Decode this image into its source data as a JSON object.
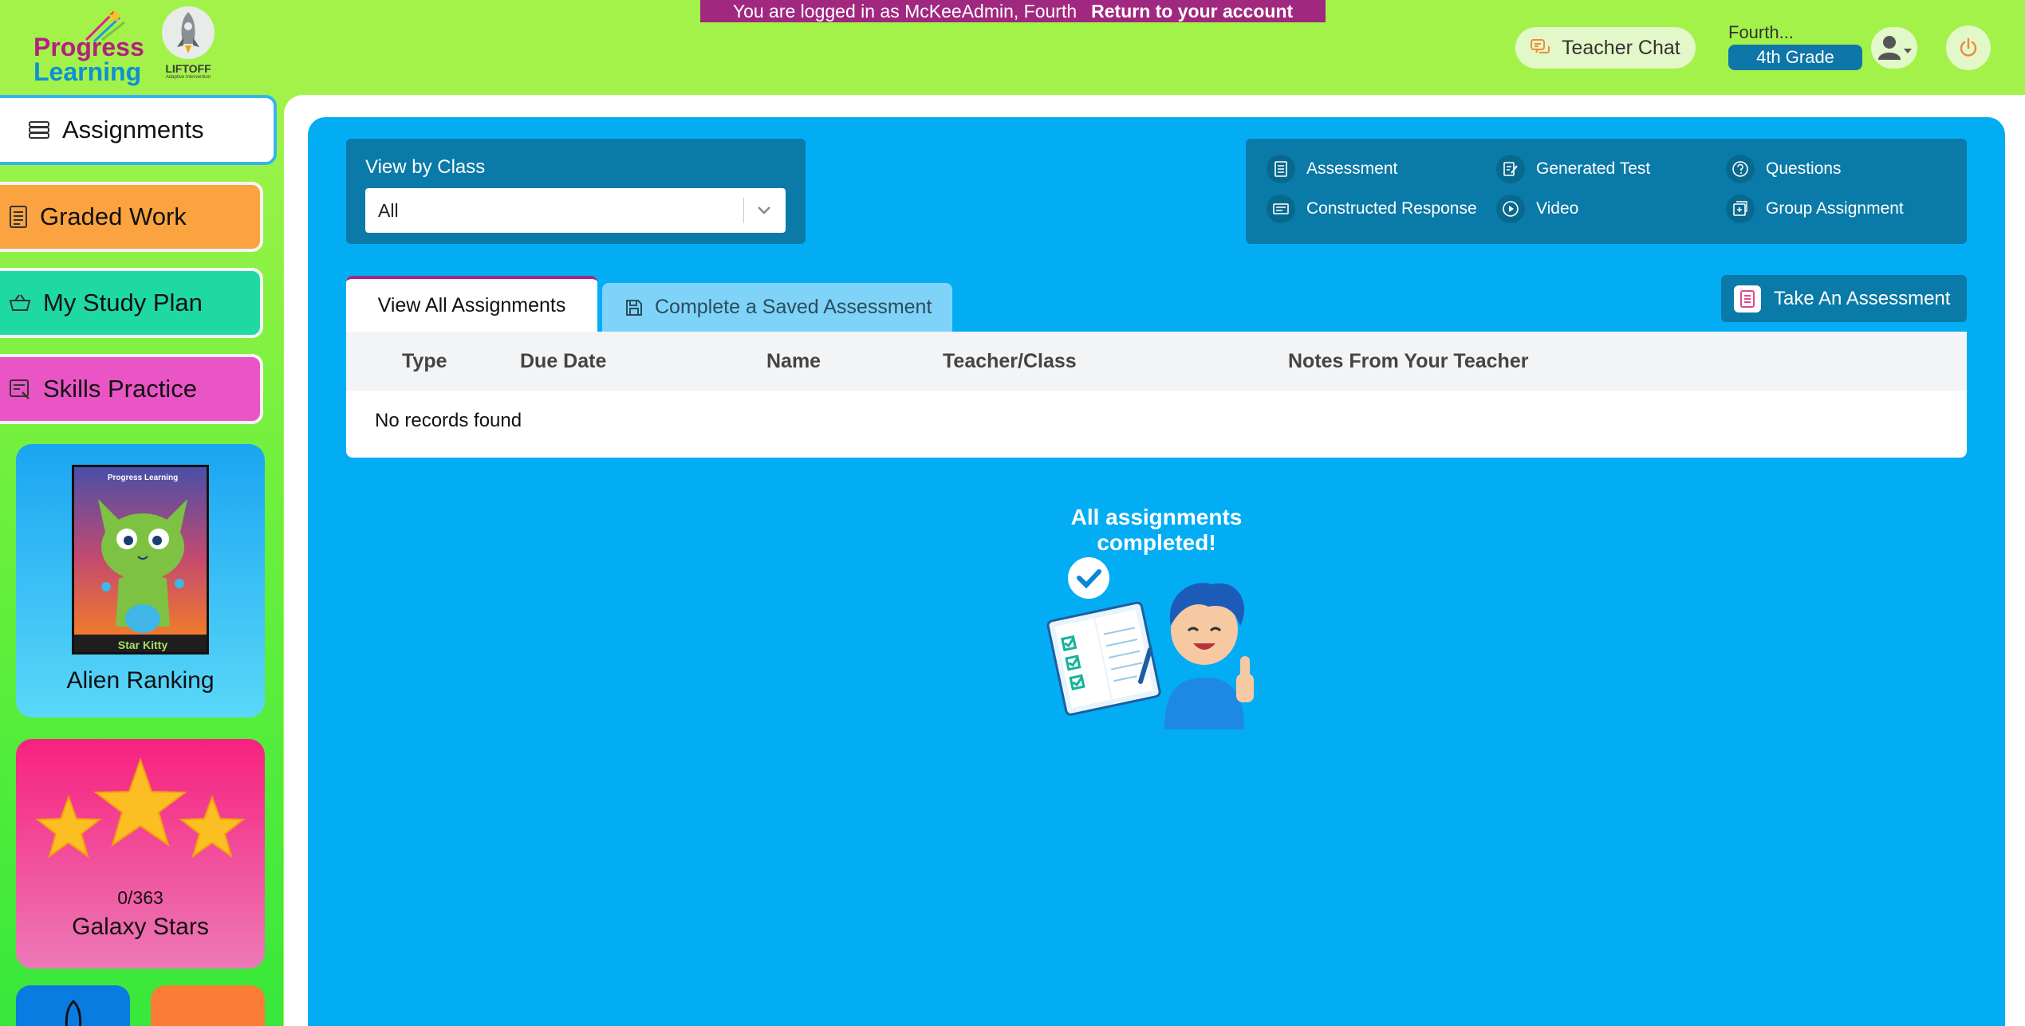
{
  "banner": {
    "logged_in_text": "You are logged in as McKeeAdmin, Fourth",
    "return_link": "Return to your account"
  },
  "brand": {
    "logo_line1": "Progress",
    "logo_line2": "Learning",
    "liftoff_word": "LIFTOFF",
    "liftoff_sub": "Adaptive Intervention"
  },
  "header": {
    "teacher_chat_label": "Teacher Chat",
    "user_name": "Fourth...",
    "grade": "4th Grade"
  },
  "sidebar": {
    "items": [
      {
        "label": "Assignments",
        "icon": "stack-icon"
      },
      {
        "label": "Graded Work",
        "icon": "document-icon"
      },
      {
        "label": "My Study Plan",
        "icon": "basket-icon"
      },
      {
        "label": "Skills Practice",
        "icon": "practice-icon"
      }
    ],
    "alien_card": {
      "title": "Alien Ranking",
      "poster_label": "Star Kitty",
      "poster_brand": "Progress Learning"
    },
    "stars_card": {
      "count": "0/363",
      "title": "Galaxy Stars"
    }
  },
  "filter": {
    "label": "View by Class",
    "selected": "All"
  },
  "legend": [
    {
      "label": "Assessment",
      "icon": "assessment-icon"
    },
    {
      "label": "Generated Test",
      "icon": "generated-test-icon"
    },
    {
      "label": "Questions",
      "icon": "questions-icon"
    },
    {
      "label": "Constructed Response",
      "icon": "constructed-response-icon"
    },
    {
      "label": "Video",
      "icon": "video-icon"
    },
    {
      "label": "Group Assignment",
      "icon": "group-assignment-icon"
    }
  ],
  "tabs": {
    "all": "View All Assignments",
    "saved": "Complete a Saved Assessment"
  },
  "take_assessment_label": "Take An Assessment",
  "table": {
    "columns": [
      "Type",
      "Due Date",
      "Name",
      "Teacher/Class",
      "Notes From Your Teacher"
    ],
    "empty_text": "No records found"
  },
  "completion": {
    "line1": "All assignments",
    "line2": "completed!"
  },
  "colors": {
    "page_bg": "#a3f24a",
    "panel_blue": "#03adf4",
    "dark_blue": "#0a7aa8",
    "banner": "#a1287f"
  }
}
